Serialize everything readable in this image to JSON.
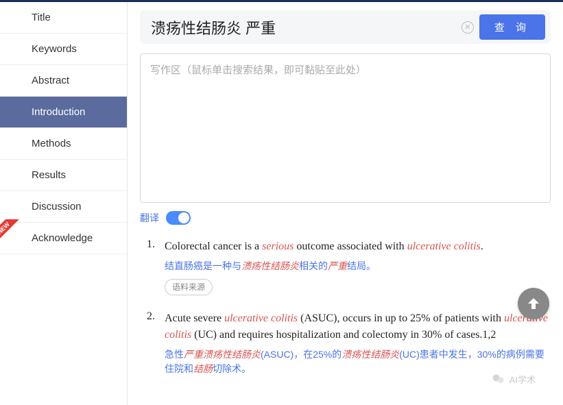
{
  "sidebar": {
    "items": [
      {
        "label": "Title"
      },
      {
        "label": "Keywords"
      },
      {
        "label": "Abstract"
      },
      {
        "label": "Introduction"
      },
      {
        "label": "Methods"
      },
      {
        "label": "Results"
      },
      {
        "label": "Discussion"
      },
      {
        "label": "Acknowledge"
      }
    ]
  },
  "search": {
    "value": "溃疡性结肠炎 严重",
    "clear_glyph": "✕",
    "button_label": "查 询"
  },
  "writing_area": {
    "placeholder": "写作区（鼠标单击搜索结果，即可黏贴至此处）"
  },
  "translate": {
    "label": "翻译"
  },
  "results": [
    {
      "num": "1.",
      "en_parts": [
        "Colorectal cancer is a ",
        "serious",
        " outcome associated with ",
        "ulcerative colitis",
        "."
      ],
      "zh_parts": [
        "结直肠癌是一种与",
        "溃疡性结肠炎",
        "相关的",
        "严重",
        "结局。"
      ],
      "corpus_label": "语料来源"
    },
    {
      "num": "2.",
      "en_parts": [
        "Acute severe ",
        "ulcerative colitis",
        " (ASUC), occurs in up to 25% of patients with ",
        "ulcerative colitis",
        " (UC) and requires hospitalization and colectomy in 30% of cases.1,2"
      ],
      "zh_parts": [
        "急性",
        "严重溃疡性结肠炎",
        "(ASUC)，在25%的",
        "溃疡性结肠炎",
        "(UC)患者中发生，30%的病例需要住院和",
        "结肠",
        "切除术。"
      ]
    }
  ],
  "watermark": {
    "text": "AI学术"
  }
}
